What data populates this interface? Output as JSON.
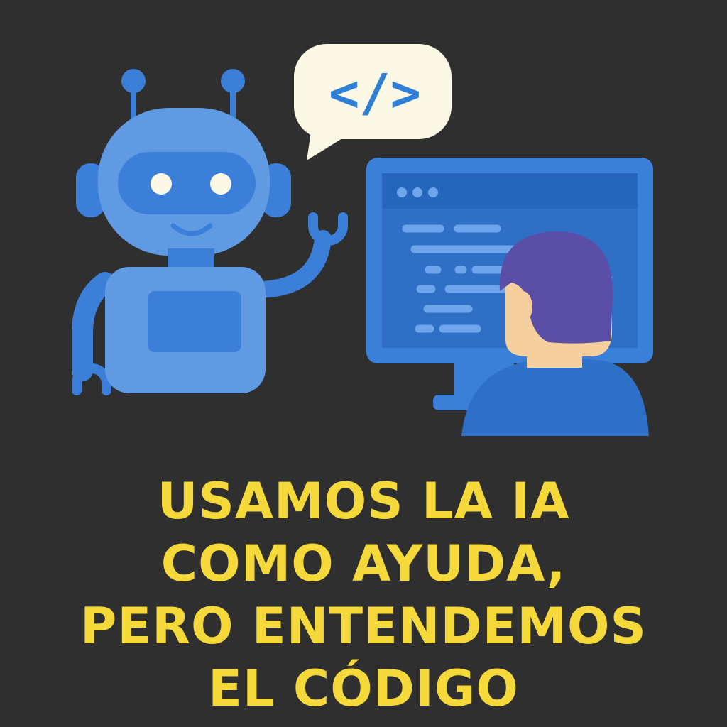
{
  "colors": {
    "background": "#2f2f2f",
    "headline": "#f5d93a",
    "robot_light": "#5f9ae2",
    "robot_dark": "#3b7fd8",
    "robot_eye": "#fbf8e6",
    "bubble": "#fbf8e6",
    "bubble_symbol": "#2f7fd6",
    "monitor_frame": "#3a80d8",
    "monitor_screen": "#2f6fc6",
    "monitor_titlebar": "#2766bd",
    "code_line": "#6da6ec",
    "person_hair": "#5b4ea6",
    "person_skin": "#f6cf9e",
    "person_shirt": "#2e6fc7"
  },
  "speech_bubble": {
    "symbol": "</>"
  },
  "headline": {
    "lines": [
      "USAMOS LA IA",
      "COMO AYUDA,",
      "PERO ENTENDEMOS",
      "EL CÓDIGO"
    ]
  }
}
